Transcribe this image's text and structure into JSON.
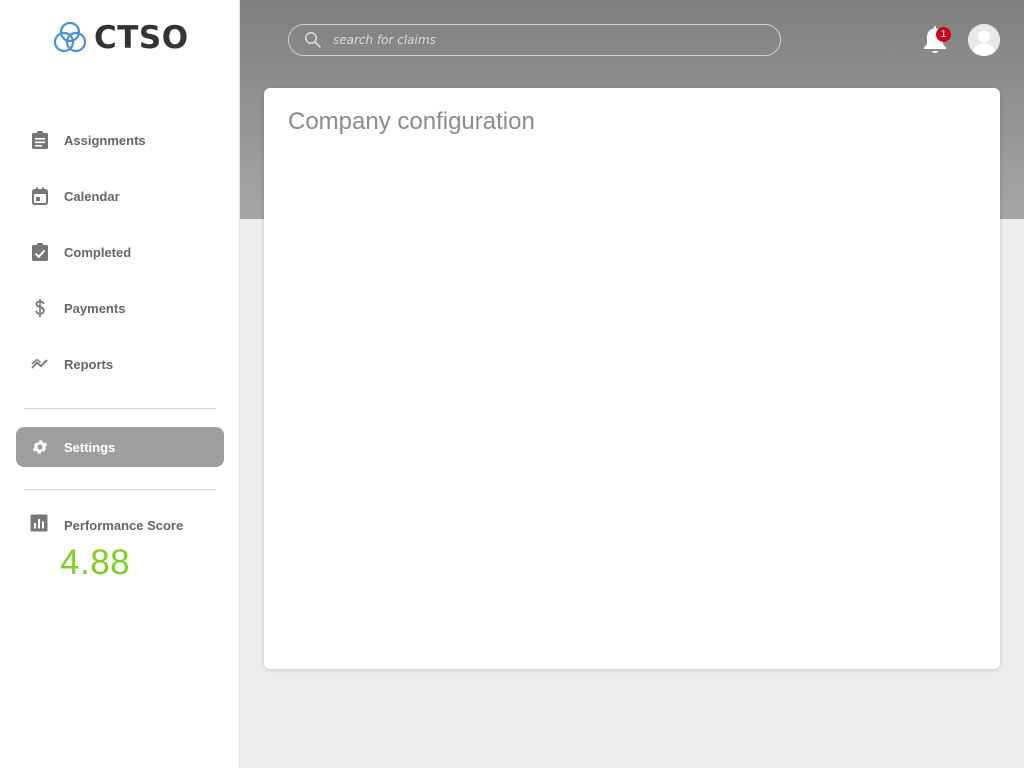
{
  "app": {
    "name": "CTSO"
  },
  "sidebar": {
    "items": [
      {
        "label": "Assignments",
        "icon": "clipboard-icon"
      },
      {
        "label": "Calendar",
        "icon": "calendar-icon"
      },
      {
        "label": "Completed",
        "icon": "clipboard-check-icon"
      },
      {
        "label": "Payments",
        "icon": "dollar-icon"
      },
      {
        "label": "Reports",
        "icon": "trending-icon"
      },
      {
        "label": "Settings",
        "icon": "gear-icon",
        "active": true
      }
    ],
    "performance": {
      "label": "Performance Score",
      "value": "4.88",
      "icon": "bar-chart-icon"
    }
  },
  "header": {
    "search": {
      "placeholder": "search for claims",
      "value": ""
    },
    "notifications": {
      "count": "1"
    }
  },
  "main": {
    "title": "Company configuration"
  },
  "colors": {
    "accent_green": "#7ed321",
    "badge_red": "#d0021b",
    "active_nav": "#9e9e9e",
    "logo_blue": "#4a90e2"
  }
}
